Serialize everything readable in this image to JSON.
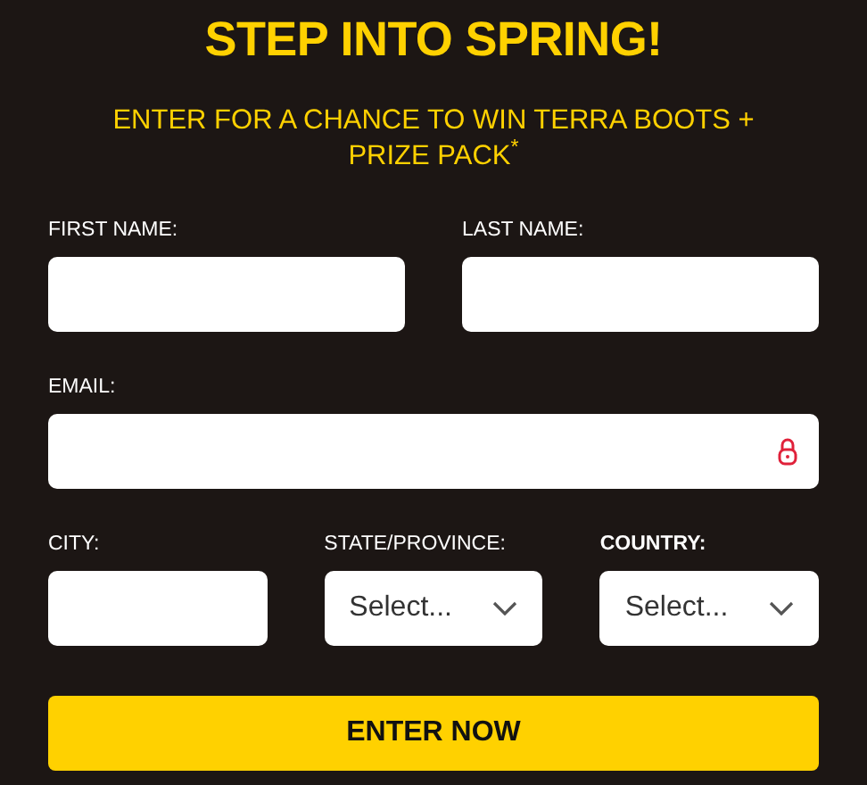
{
  "title": "STEP INTO SPRING!",
  "subtitle": "ENTER FOR A CHANCE TO WIN TERRA BOOTS + PRIZE PACK$^{*}$",
  "rows": [
    {
      "fields": [
        {
          "label": "FIRST NAME:",
          "kind": "text",
          "bold": false
        },
        {
          "label": "LAST NAME:",
          "kind": "text",
          "bold": false
        }
      ]
    },
    {
      "fields": [
        {
          "label": "EMAIL:",
          "kind": "email",
          "bold": false
        }
      ]
    },
    {
      "fields": [
        {
          "label": "CITY:",
          "kind": "text",
          "bold": false
        },
        {
          "label": "STATE/PROVINCE:",
          "kind": "select",
          "value": "Select...",
          "bold": false
        },
        {
          "label": "COUNTRY:",
          "kind": "select",
          "value": "Select...",
          "bold": true
        }
      ]
    }
  ],
  "submit": "ENTER NOW"
}
